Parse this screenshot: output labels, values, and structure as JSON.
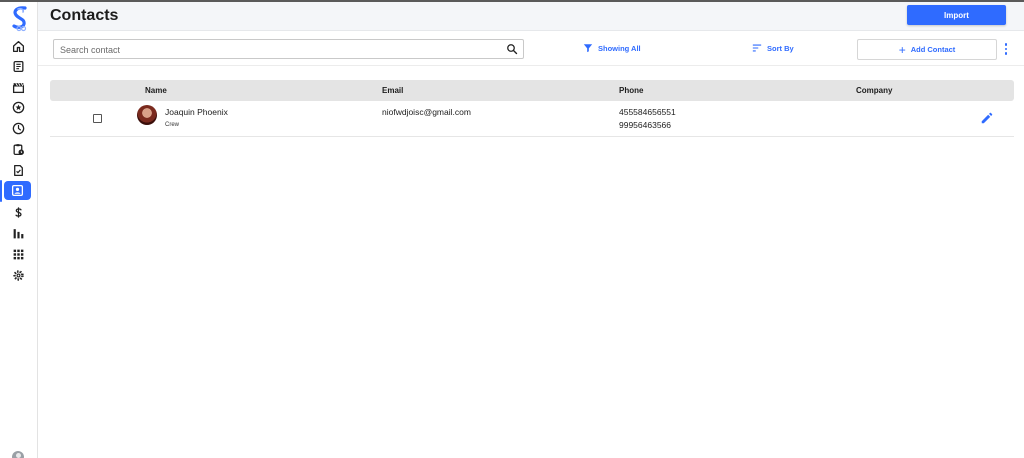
{
  "header": {
    "title": "Contacts",
    "import_label": "Import"
  },
  "toolbar": {
    "search_placeholder": "Search contact",
    "search_value": "",
    "filter_label": "Showing All",
    "sort_label": "Sort By",
    "add_contact_label": "Add Contact"
  },
  "sidebar": {
    "items": [
      {
        "icon": "home-icon"
      },
      {
        "icon": "document-icon"
      },
      {
        "icon": "clapperboard-icon"
      },
      {
        "icon": "star-badge-icon"
      },
      {
        "icon": "clock-icon"
      },
      {
        "icon": "clipboard-clock-icon"
      },
      {
        "icon": "checklist-icon"
      },
      {
        "icon": "contacts-icon",
        "active": true
      },
      {
        "icon": "dollar-icon"
      },
      {
        "icon": "bar-chart-icon"
      },
      {
        "icon": "apps-grid-icon"
      },
      {
        "icon": "settings-gear-icon"
      }
    ]
  },
  "table": {
    "columns": [
      "Name",
      "Email",
      "Phone",
      "Company"
    ],
    "rows": [
      {
        "name": "Joaquin Phoenix",
        "role": "Crew",
        "email": "niofwdjoisc@gmail.com",
        "phones": [
          "455584656551",
          "99956463566"
        ],
        "company": ""
      }
    ]
  },
  "colors": {
    "accent": "#2f6bff",
    "header_bg": "#f4f6f9",
    "table_head_bg": "#e4e4e4"
  }
}
